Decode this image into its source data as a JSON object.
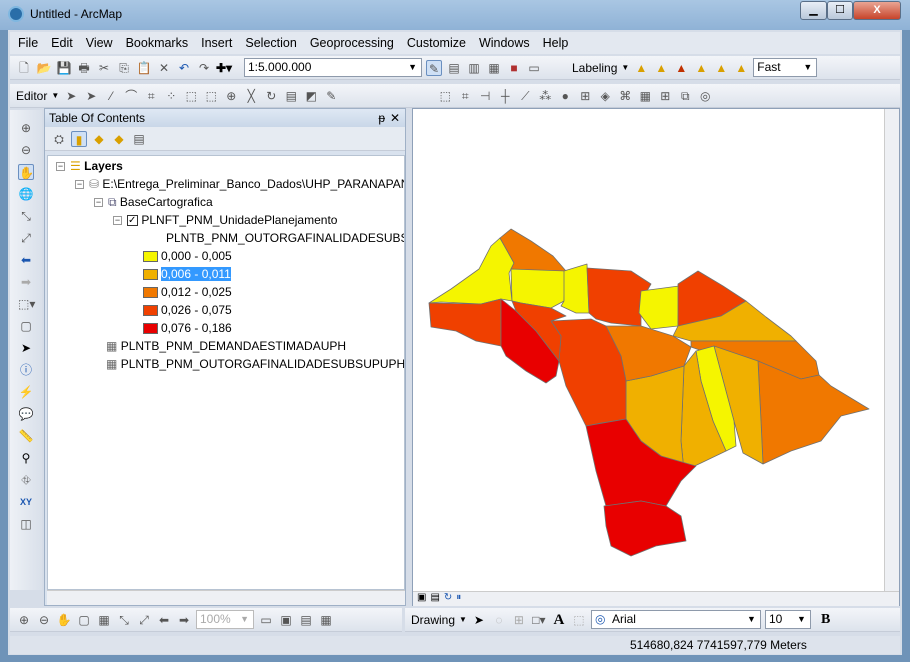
{
  "window": {
    "title": "Untitled - ArcMap",
    "minimize": "▁",
    "maximize": "☐",
    "close": "X"
  },
  "menu": [
    "File",
    "Edit",
    "View",
    "Bookmarks",
    "Insert",
    "Selection",
    "Geoprocessing",
    "Customize",
    "Windows",
    "Help"
  ],
  "toolbar": {
    "scale": "1:5.000.000",
    "labeling": "Labeling",
    "quality": "Fast",
    "editor": "Editor"
  },
  "toc": {
    "title": "Table Of Contents",
    "pin": "ᵽ",
    "close": "✕",
    "layers_label": "Layers",
    "database": "E:\\Entrega_Preliminar_Banco_Dados\\UHP_PARANAPAN",
    "group": "BaseCartografica",
    "layer": "PLNFT_PNM_UnidadePlanejamento",
    "field": "PLNTB_PNM_OUTORGAFINALIDADESUBSUP",
    "classes": [
      {
        "label": "0,000 - 0,005",
        "color": "#f5f500"
      },
      {
        "label": "0,006 - 0,011",
        "color": "#f0b000",
        "selected": true
      },
      {
        "label": "0,012 - 0,025",
        "color": "#f07800"
      },
      {
        "label": "0,026 - 0,075",
        "color": "#f04000"
      },
      {
        "label": "0,076 - 0,186",
        "color": "#e80000"
      }
    ],
    "tables": [
      "PLNTB_PNM_DEMANDAESTIMADAUPH",
      "PLNTB_PNM_OUTORGAFINALIDADESUBSUPUPH"
    ]
  },
  "drawing": {
    "label": "Drawing",
    "font": "Arial",
    "size": "10",
    "bold": "B",
    "zoom": "100%"
  },
  "status": {
    "coords": "514680,824  7741597,779 Meters"
  }
}
